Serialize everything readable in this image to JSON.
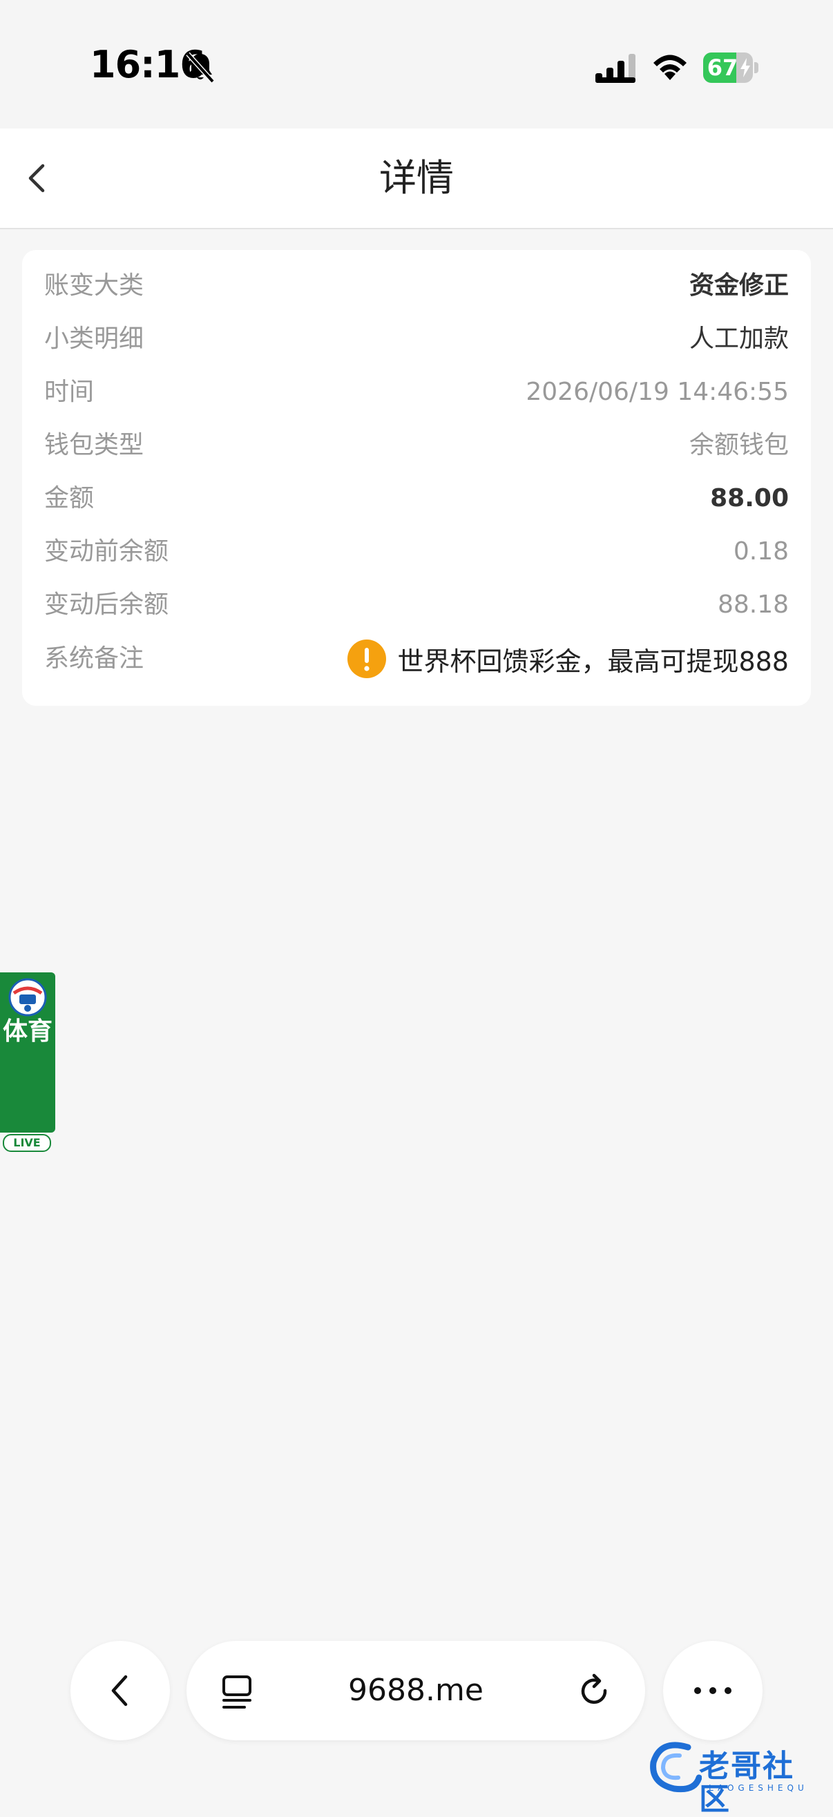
{
  "status_bar": {
    "time": "16:16",
    "battery_percent": "67",
    "battery_level": 0.67,
    "icons": [
      "bell-off-icon",
      "cellular-signal-icon",
      "wifi-icon",
      "battery-icon",
      "charging-bolt-icon"
    ]
  },
  "header": {
    "title": "详情",
    "back_icon": "chevron-left-icon"
  },
  "details": {
    "rows": [
      {
        "label": "账变大类",
        "value": "资金修正"
      },
      {
        "label": "小类明细",
        "value": "人工加款"
      },
      {
        "label": "时间",
        "value": "2026/06/19 14:46:55"
      },
      {
        "label": "钱包类型",
        "value": "余额钱包"
      },
      {
        "label": "金额",
        "value": "88.00"
      },
      {
        "label": "变动前余额",
        "value": "0.18"
      },
      {
        "label": "变动后余额",
        "value": "88.18"
      },
      {
        "label": "系统备注",
        "value": "世界杯回馈彩金，最高可提现888"
      }
    ],
    "note_icon": "warning-icon"
  },
  "sports_badge": {
    "text": "体育",
    "tag": "LIVE",
    "icon": "soccer-ball-icon"
  },
  "browser_bar": {
    "url": "9688.me",
    "icons": [
      "chevron-left-icon",
      "tabs-icon",
      "reload-icon",
      "more-icon"
    ]
  },
  "watermark": {
    "text": "老哥社区",
    "subtext": "LAOGESHEQU"
  },
  "colors": {
    "background": "#f6f6f6",
    "card": "#ffffff",
    "label": "#999999",
    "value_dark": "#333333",
    "warning": "#f5a10f",
    "battery_green": "#34c759",
    "sports_green": "#19893a",
    "watermark_blue": "#1f6fd6"
  }
}
